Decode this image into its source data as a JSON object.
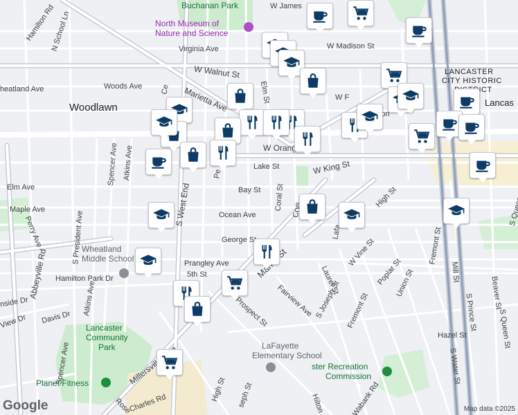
{
  "map": {
    "credit": "Map data ©2025",
    "logo": "Google"
  },
  "neighborhoods": [
    {
      "name": "Woodlawn"
    }
  ],
  "district": {
    "line1": "LANCASTER",
    "line2": "CITY HISTORIC",
    "line3": "DISTRICT"
  },
  "city_partial": "Lancas",
  "pois": [
    {
      "name": "Buchanan Park",
      "kind": "park"
    },
    {
      "name_line1": "North Museum of",
      "name_line2": "Nature and Science",
      "kind": "museum"
    },
    {
      "name_line1": "Wheatland",
      "name_line2": "Middle School",
      "kind": "school"
    },
    {
      "name_line1": "Lancaster",
      "name_line2": "Community",
      "name_line3": "Park",
      "kind": "park"
    },
    {
      "name": "Planet Fitness",
      "kind": "gym"
    },
    {
      "name_line1": "LaFayette",
      "name_line2": "Elementary School",
      "kind": "school"
    },
    {
      "name_line1": "ster Recreation",
      "name_line2": "Commission",
      "kind": "park"
    }
  ],
  "streets": [
    "W James",
    "Hamilton Rd",
    "N School Ln",
    "Virginia Ave",
    "W Madison St",
    "W Walnut St",
    "heatland Ave",
    "Woods Ave",
    "Marietta Ave",
    "Elm St",
    "W F",
    "W Orange",
    "Lake St",
    "W King St",
    "Elm Ave",
    "Bay St",
    "Maple Ave",
    "Ocean Ave",
    "Perry Ave",
    "Spencer Ave",
    "Atkins Ave",
    "S President Ave",
    "George St",
    "Hamilton Park Dr",
    "Prangley Ave",
    "5th St",
    "Coral St",
    "Manor St",
    "S West End",
    "Abbeyville Rd",
    "Davis Dr",
    "nside Dr",
    "View Dr",
    "Spencer Ave",
    "Atkins Ave",
    "Fairview Ave",
    "Prospect St",
    "Laurel St",
    "S Joseph St",
    "W Vine St",
    "Poplar St",
    "Fremont St",
    "Union St",
    "Mill St",
    "S Prince St",
    "S Queen St",
    "Beaver St",
    "Hazel St",
    "S Water St",
    "High St",
    "Charles Rd",
    "Millersville Pike",
    "High St",
    "seph St",
    "Hilton",
    "Wabank Rd",
    "Rose",
    "Pe",
    "Ce",
    "ion",
    "High St",
    "S Queen",
    "Fremont St",
    "Lafa",
    "Crys"
  ],
  "markers": [
    {
      "type": "coffee"
    },
    {
      "type": "shopping-cart"
    },
    {
      "type": "coffee"
    },
    {
      "type": "school"
    },
    {
      "type": "school"
    },
    {
      "type": "school"
    },
    {
      "type": "shopping-bag"
    },
    {
      "type": "shopping-cart"
    },
    {
      "type": "school"
    },
    {
      "type": "school"
    },
    {
      "type": "shopping-bag"
    },
    {
      "type": "school"
    },
    {
      "type": "restaurant"
    },
    {
      "type": "restaurant"
    },
    {
      "type": "shopping-bag"
    },
    {
      "type": "restaurant"
    },
    {
      "type": "restaurant"
    },
    {
      "type": "restaurant"
    },
    {
      "type": "coffee"
    },
    {
      "type": "shopping-cart"
    },
    {
      "type": "coffee"
    },
    {
      "type": "coffee"
    },
    {
      "type": "school"
    },
    {
      "type": "shopping-bag"
    },
    {
      "type": "restaurant"
    },
    {
      "type": "coffee"
    },
    {
      "type": "shopping-bag"
    },
    {
      "type": "school"
    },
    {
      "type": "shopping-bag"
    },
    {
      "type": "school"
    },
    {
      "type": "school"
    },
    {
      "type": "restaurant"
    },
    {
      "type": "school"
    },
    {
      "type": "shopping-cart"
    },
    {
      "type": "restaurant"
    },
    {
      "type": "shopping-bag"
    },
    {
      "type": "shopping-cart"
    },
    {
      "type": "school"
    },
    {
      "type": "coffee"
    }
  ]
}
